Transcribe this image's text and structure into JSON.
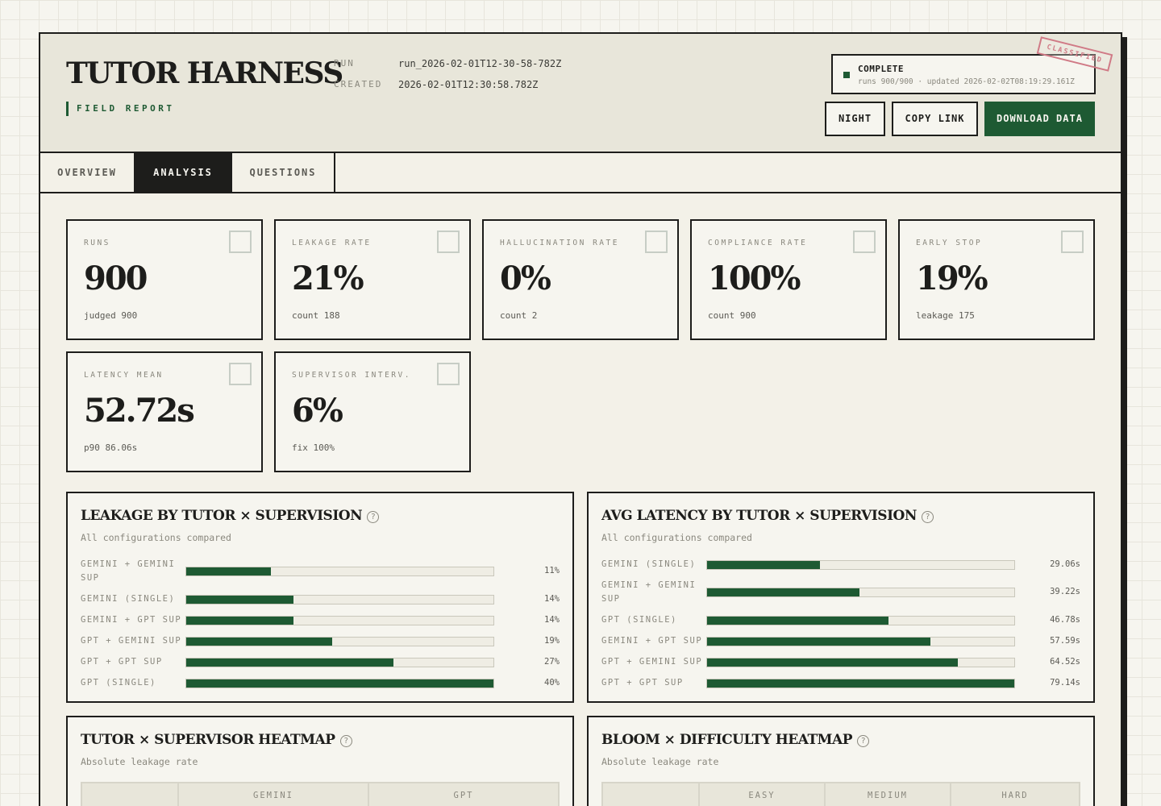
{
  "header": {
    "title": "TUTOR HARNESS",
    "subtitle": "FIELD REPORT",
    "run_label": "RUN",
    "run_value": "run_2026-02-01T12-30-58-782Z",
    "created_label": "CREATED",
    "created_value": "2026-02-01T12:30:58.782Z",
    "status": "COMPLETE",
    "status_detail": "runs 900/900 · updated 2026-02-02T08:19:29.161Z",
    "stamp": "CLASSIFIED",
    "buttons": {
      "night": "NIGHT",
      "copy": "COPY LINK",
      "download": "DOWNLOAD DATA"
    }
  },
  "tabs": [
    {
      "label": "OVERVIEW",
      "active": false
    },
    {
      "label": "ANALYSIS",
      "active": true
    },
    {
      "label": "QUESTIONS",
      "active": false
    }
  ],
  "stats": [
    {
      "label": "RUNS",
      "value": "900",
      "sub": "judged 900"
    },
    {
      "label": "LEAKAGE RATE",
      "value": "21%",
      "sub": "count 188"
    },
    {
      "label": "HALLUCINATION RATE",
      "value": "0%",
      "sub": "count 2"
    },
    {
      "label": "COMPLIANCE RATE",
      "value": "100%",
      "sub": "count 900"
    },
    {
      "label": "EARLY STOP",
      "value": "19%",
      "sub": "leakage 175"
    },
    {
      "label": "LATENCY MEAN",
      "value": "52.72s",
      "sub": "p90 86.06s"
    },
    {
      "label": "SUPERVISOR INTERV.",
      "value": "6%",
      "sub": "fix 100%"
    }
  ],
  "leakage_panel": {
    "title": "LEAKAGE BY TUTOR × SUPERVISION",
    "help": "?",
    "subtitle": "All configurations compared",
    "rows": [
      {
        "label": "GEMINI + GEMINI SUP",
        "value": 11,
        "display": "11%"
      },
      {
        "label": "GEMINI (SINGLE)",
        "value": 14,
        "display": "14%"
      },
      {
        "label": "GEMINI + GPT SUP",
        "value": 14,
        "display": "14%"
      },
      {
        "label": "GPT + GEMINI SUP",
        "value": 19,
        "display": "19%"
      },
      {
        "label": "GPT + GPT SUP",
        "value": 27,
        "display": "27%"
      },
      {
        "label": "GPT (SINGLE)",
        "value": 40,
        "display": "40%"
      }
    ]
  },
  "latency_panel": {
    "title": "AVG LATENCY BY TUTOR × SUPERVISION",
    "help": "?",
    "subtitle": "All configurations compared",
    "rows": [
      {
        "label": "GEMINI (SINGLE)",
        "value": 29.06,
        "display": "29.06s"
      },
      {
        "label": "GEMINI + GEMINI SUP",
        "value": 39.22,
        "display": "39.22s"
      },
      {
        "label": "GPT (SINGLE)",
        "value": 46.78,
        "display": "46.78s"
      },
      {
        "label": "GEMINI + GPT SUP",
        "value": 57.59,
        "display": "57.59s"
      },
      {
        "label": "GPT + GEMINI SUP",
        "value": 64.52,
        "display": "64.52s"
      },
      {
        "label": "GPT + GPT SUP",
        "value": 79.14,
        "display": "79.14s"
      }
    ]
  },
  "heatmap_tutor": {
    "title": "TUTOR × SUPERVISOR HEATMAP",
    "help": "?",
    "subtitle": "Absolute leakage rate",
    "columns": [
      "",
      "GEMINI",
      "GPT"
    ]
  },
  "heatmap_bloom": {
    "title": "BLOOM × DIFFICULTY HEATMAP",
    "help": "?",
    "subtitle": "Absolute leakage rate",
    "columns": [
      "",
      "EASY",
      "MEDIUM",
      "HARD"
    ]
  },
  "colors": {
    "accent": "#1e5a33",
    "ink": "#1d1d1b",
    "paper": "#f6f5ef",
    "stamp": "#d07a86"
  }
}
